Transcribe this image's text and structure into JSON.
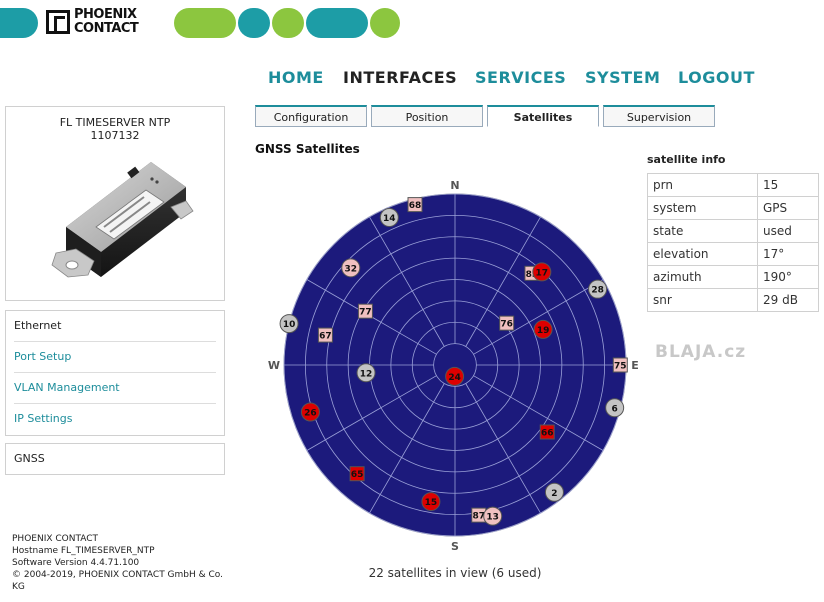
{
  "brand": {
    "logo_line1": "PHOENIX",
    "logo_line2": "CONTACT",
    "colors": {
      "teal": "#1d9da6",
      "green": "#8cc63f"
    }
  },
  "nav": [
    {
      "label": "HOME",
      "active": false
    },
    {
      "label": "INTERFACES",
      "active": true
    },
    {
      "label": "SERVICES",
      "active": false
    },
    {
      "label": "SYSTEM",
      "active": false
    },
    {
      "label": "LOGOUT",
      "active": false
    }
  ],
  "device": {
    "name": "FL TIMESERVER NTP",
    "part_number": "1107132"
  },
  "sidebar": {
    "ethernet_header": "Ethernet",
    "items": [
      "Port Setup",
      "VLAN Management",
      "IP Settings"
    ],
    "gnss_header": "GNSS"
  },
  "footer": {
    "company": "PHOENIX CONTACT",
    "hostname": "Hostname FL_TIMESERVER_NTP",
    "software": "Software Version 4.4.71.100",
    "copyright_line1": "© 2004-2019, PHOENIX CONTACT GmbH & Co.",
    "copyright_line2": "KG"
  },
  "tabs": [
    {
      "label": "Configuration",
      "active": false
    },
    {
      "label": "Position",
      "active": false
    },
    {
      "label": "Satellites",
      "active": true
    },
    {
      "label": "Supervision",
      "active": false
    }
  ],
  "section_title": "GNSS Satellites",
  "compass": {
    "n": "N",
    "e": "E",
    "s": "S",
    "w": "W"
  },
  "satellites": [
    {
      "prn": "14",
      "system": "GPS",
      "state": "not used",
      "elevation": 5,
      "azimuth": 336
    },
    {
      "prn": "68",
      "system": "GLONASS",
      "state": "in view",
      "elevation": 3,
      "azimuth": 346
    },
    {
      "prn": "32",
      "system": "GPS",
      "state": "in view",
      "elevation": 15,
      "azimuth": 313
    },
    {
      "prn": "85",
      "system": "GLONASS",
      "state": "in view",
      "elevation": 27,
      "azimuth": 40
    },
    {
      "prn": "17",
      "system": "GPS",
      "state": "used",
      "elevation": 23,
      "azimuth": 43
    },
    {
      "prn": "28",
      "system": "GPS",
      "state": "not used",
      "elevation": 5,
      "azimuth": 62
    },
    {
      "prn": "77",
      "system": "GLONASS",
      "state": "in view",
      "elevation": 35,
      "azimuth": 301
    },
    {
      "prn": "76",
      "system": "GLONASS",
      "state": "in view",
      "elevation": 55,
      "azimuth": 51
    },
    {
      "prn": "19",
      "system": "GPS",
      "state": "used",
      "elevation": 40,
      "azimuth": 68
    },
    {
      "prn": "10",
      "system": "GPS",
      "state": "not used",
      "elevation": 0,
      "azimuth": 284
    },
    {
      "prn": "67",
      "system": "GLONASS",
      "state": "in view",
      "elevation": 20,
      "azimuth": 283
    },
    {
      "prn": "75",
      "system": "GLONASS",
      "state": "in view",
      "elevation": 3,
      "azimuth": 90
    },
    {
      "prn": "12",
      "system": "GPS",
      "state": "not used",
      "elevation": 43,
      "azimuth": 265
    },
    {
      "prn": "24",
      "system": "GPS",
      "state": "used",
      "elevation": 84,
      "azimuth": 182
    },
    {
      "prn": "26",
      "system": "GPS",
      "state": "used",
      "elevation": 10,
      "azimuth": 252
    },
    {
      "prn": "6",
      "system": "GPS",
      "state": "not used",
      "elevation": 3,
      "azimuth": 105
    },
    {
      "prn": "66",
      "system": "GLONASS",
      "state": "used",
      "elevation": 30,
      "azimuth": 126
    },
    {
      "prn": "2",
      "system": "GPS",
      "state": "not used",
      "elevation": 5,
      "azimuth": 142
    },
    {
      "prn": "65",
      "system": "GLONASS",
      "state": "used",
      "elevation": 13,
      "azimuth": 222
    },
    {
      "prn": "15",
      "system": "GPS",
      "state": "used",
      "elevation": 17,
      "azimuth": 190
    },
    {
      "prn": "87",
      "system": "GLONASS",
      "state": "in view",
      "elevation": 10,
      "azimuth": 171
    },
    {
      "prn": "13",
      "system": "GPS",
      "state": "in view",
      "elevation": 8,
      "azimuth": 166
    }
  ],
  "sat_count_text": "22 satellites in view (6 used)",
  "satellite_info": {
    "title": "satellite info",
    "rows": [
      {
        "key": "prn",
        "value": "15"
      },
      {
        "key": "system",
        "value": "GPS"
      },
      {
        "key": "state",
        "value": "used"
      },
      {
        "key": "elevation",
        "value": "17°"
      },
      {
        "key": "azimuth",
        "value": "190°"
      },
      {
        "key": "snr",
        "value": "29 dB"
      }
    ]
  },
  "watermark": "BLAJA.cz",
  "plot_colors": {
    "sky": "#1c1a7c",
    "used": "#dd0000",
    "not_used": "#c4c4c4",
    "in_view": "#f0c0c0"
  }
}
